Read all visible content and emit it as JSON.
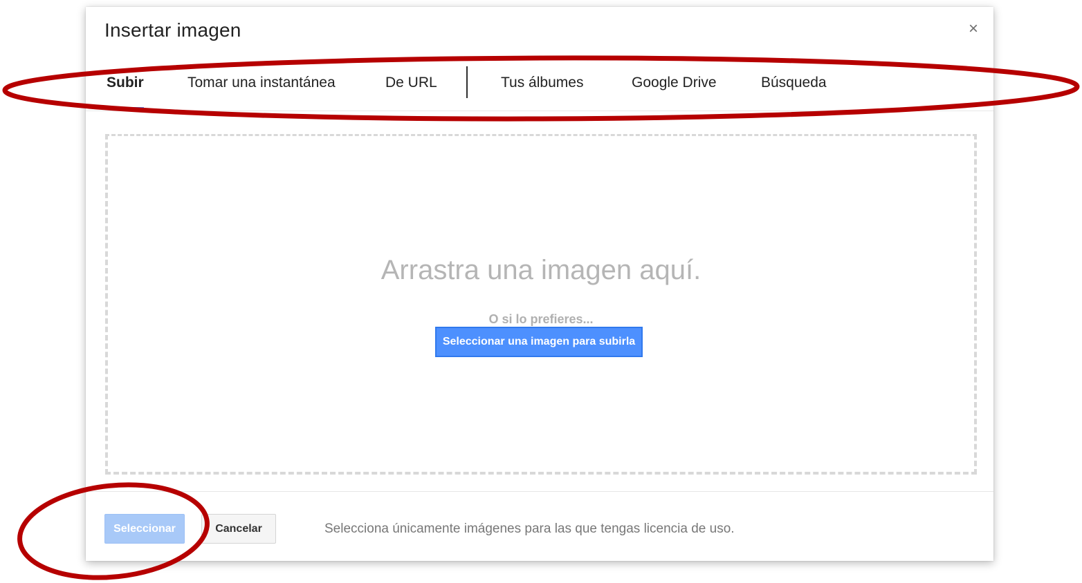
{
  "dialog": {
    "title": "Insertar imagen",
    "close_label": "×"
  },
  "tabs": [
    {
      "label": "Subir",
      "active": true
    },
    {
      "label": "Tomar una instantánea",
      "active": false
    },
    {
      "label": "De URL",
      "active": false
    },
    {
      "label": "Tus álbumes",
      "active": false
    },
    {
      "label": "Google Drive",
      "active": false
    },
    {
      "label": "Búsqueda",
      "active": false
    }
  ],
  "dropzone": {
    "title": "Arrastra una imagen aquí.",
    "or_text": "O si lo prefieres...",
    "button_label": "Seleccionar una imagen para subirla"
  },
  "footer": {
    "select_label": "Seleccionar",
    "cancel_label": "Cancelar",
    "note": "Selecciona únicamente imágenes para las que tengas licencia de uso."
  },
  "colors": {
    "accent": "#4d90fe",
    "select_disabled": "#a8c9f8",
    "annotation": "#b60000"
  },
  "icons": {
    "close": "close-icon"
  }
}
